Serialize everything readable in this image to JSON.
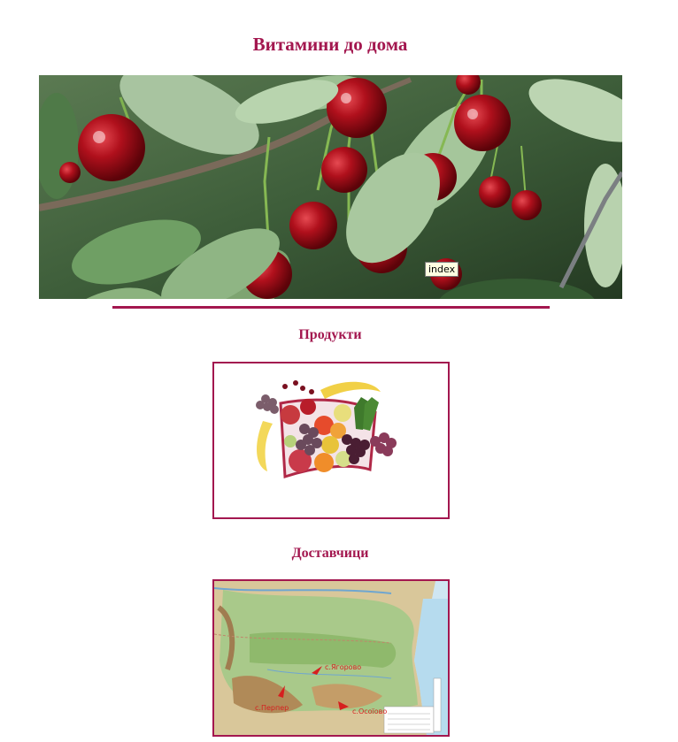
{
  "page": {
    "title": "Витамини до дома"
  },
  "banner": {
    "image_alt": "cherries-banner",
    "tooltip": "index"
  },
  "sections": {
    "products": {
      "heading": "Продукти",
      "image_alt": "fruit-basket"
    },
    "suppliers": {
      "heading": "Доставчици",
      "image_alt": "bulgaria-map",
      "map_labels": [
        "с.Ягорово",
        "с.Перпер",
        "с.Осоїово"
      ]
    }
  },
  "colors": {
    "accent": "#a3174f",
    "cherry": "#b0101c",
    "leaf": "#7fa873"
  }
}
